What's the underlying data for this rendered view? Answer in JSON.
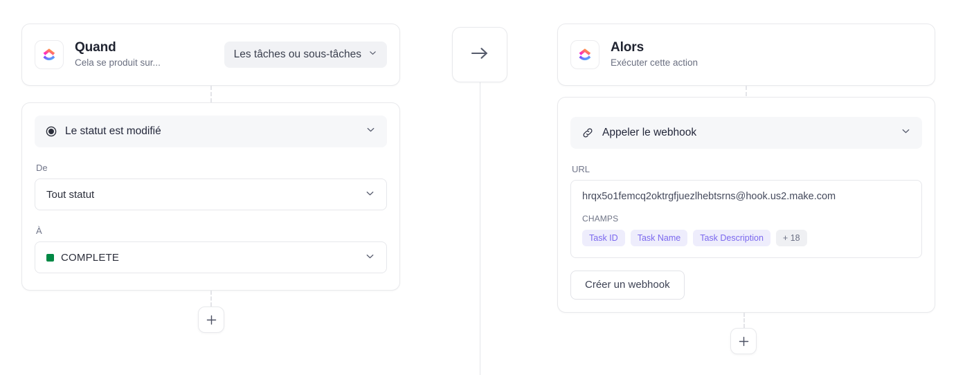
{
  "colors": {
    "accent_purple": "#7b68ee",
    "status_complete": "#008844",
    "tag_bg": "#eeedfc",
    "card_border": "#e8e9ec"
  },
  "trigger": {
    "logo_icon": "clickup-logo-icon",
    "title": "Quand",
    "subtitle": "Cela se produit sur...",
    "scope_pill": {
      "label": "Les tâches ou sous-tâches",
      "chevron_icon": "chevron-down-icon"
    },
    "condition": {
      "icon": "status-radio-icon",
      "label": "Le statut est modifié",
      "chevron_icon": "chevron-down-icon"
    },
    "from": {
      "label": "De",
      "value": "Tout statut",
      "chevron_icon": "chevron-down-icon"
    },
    "to": {
      "label": "À",
      "value": "COMPLETE",
      "swatch_color": "#008844",
      "chevron_icon": "chevron-down-icon"
    },
    "add_button_icon": "plus-icon"
  },
  "connector": {
    "arrow_icon": "arrow-right-icon"
  },
  "action": {
    "logo_icon": "clickup-logo-icon",
    "title": "Alors",
    "subtitle": "Exécuter cette action",
    "action_select": {
      "icon": "link-icon",
      "label": "Appeler le webhook",
      "chevron_icon": "chevron-down-icon"
    },
    "url": {
      "label": "URL",
      "value": "hrqx5o1femcq2oktrgfjuezlhebtsrns@hook.us2.make.com",
      "fields_label": "CHAMPS",
      "tags": [
        "Task ID",
        "Task Name",
        "Task Description"
      ],
      "more_tag": "+ 18"
    },
    "create_button": "Créer un webhook",
    "add_button_icon": "plus-icon"
  }
}
